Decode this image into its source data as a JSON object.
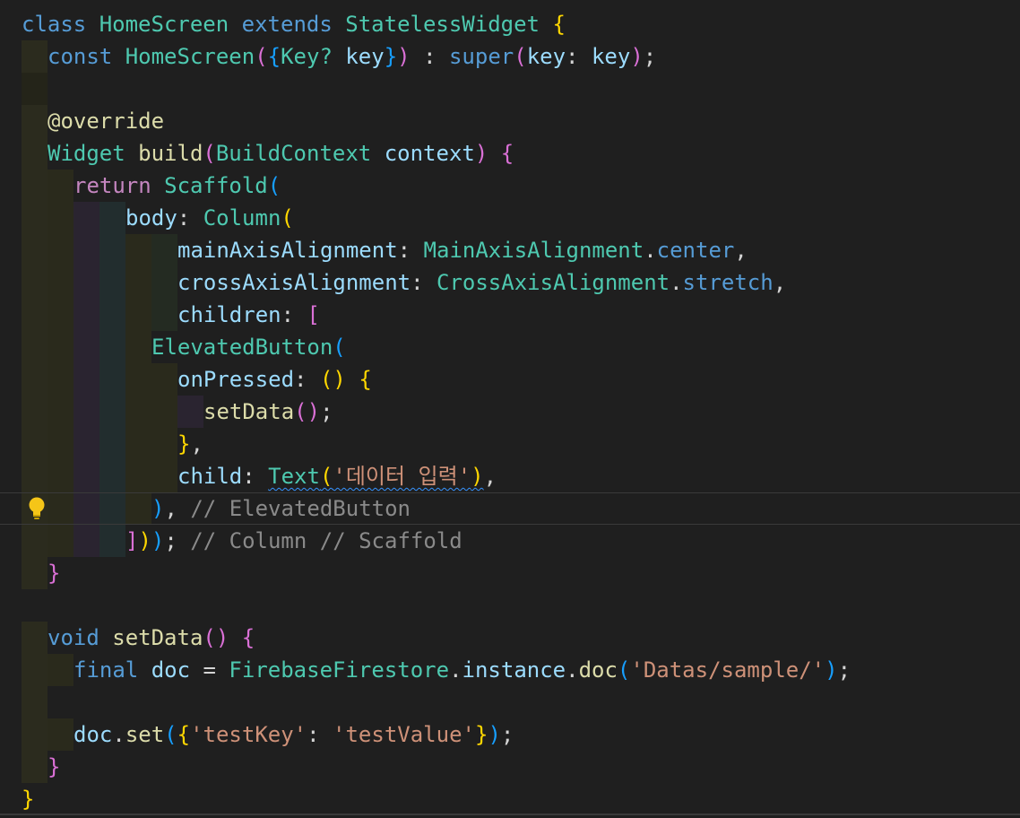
{
  "code": {
    "l1": {
      "kw_class": "class",
      "name": "HomeScreen",
      "kw_extends": "extends",
      "base": "StatelessWidget",
      "brace": "{"
    },
    "l2": {
      "kw_const": "const",
      "name": "HomeScreen",
      "p_open": "(",
      "b_open": "{",
      "type": "Key?",
      "param": "key",
      "b_close": "}",
      "p_close": ")",
      "colon": " : ",
      "super": "super",
      "sp_open": "(",
      "named": "key",
      "sep": ": ",
      "value": "key",
      "sp_close": ")",
      "semi": ";"
    },
    "l4": {
      "annotation": "@override"
    },
    "l5": {
      "ret_type": "Widget",
      "name": "build",
      "p_open": "(",
      "ptype": "BuildContext",
      "pname": "context",
      "p_close": ")",
      "brace": "{"
    },
    "l6": {
      "kw_return": "return",
      "widget": "Scaffold",
      "p_open": "("
    },
    "l7": {
      "prop": "body",
      "sep": ": ",
      "widget": "Column",
      "p_open": "("
    },
    "l8": {
      "prop": "mainAxisAlignment",
      "sep": ": ",
      "enum": "MainAxisAlignment",
      "dot": ".",
      "value": "center",
      "comma": ","
    },
    "l9": {
      "prop": "crossAxisAlignment",
      "sep": ": ",
      "enum": "CrossAxisAlignment",
      "dot": ".",
      "value": "stretch",
      "comma": ","
    },
    "l10": {
      "prop": "children",
      "sep": ": ",
      "bracket": "["
    },
    "l11": {
      "widget": "ElevatedButton",
      "p_open": "("
    },
    "l12": {
      "prop": "onPressed",
      "sep": ": ",
      "parens": "()",
      "brace": "{"
    },
    "l13": {
      "call": "setData",
      "parens": "()",
      "semi": ";"
    },
    "l14": {
      "brace": "}",
      "comma": ","
    },
    "l15": {
      "prop": "child",
      "sep": ": ",
      "widget": "Text",
      "p_open": "(",
      "string": "'데이터 입력'",
      "p_close": ")",
      "comma": ","
    },
    "l16": {
      "p_close": ")",
      "comma": ",",
      "comment": "// ElevatedButton"
    },
    "l17": {
      "bracket": "]",
      "p_close1": ")",
      "p_close2": ")",
      "semi": ";",
      "comment": "// Column // Scaffold"
    },
    "l18": {
      "brace": "}"
    },
    "l20": {
      "kw_void": "void",
      "name": "setData",
      "parens": "()",
      "brace": "{"
    },
    "l21": {
      "kw_final": "final",
      "var": "doc",
      "eq": " = ",
      "cls": "FirebaseFirestore",
      "dot1": ".",
      "member": "instance",
      "dot2": ".",
      "method": "doc",
      "p_open": "(",
      "string": "'Datas/sample/'",
      "p_close": ")",
      "semi": ";"
    },
    "l23": {
      "obj": "doc",
      "dot": ".",
      "method": "set",
      "p_open": "(",
      "b_open": "{",
      "key": "'testKey'",
      "sep": ": ",
      "value": "'testValue'",
      "b_close": "}",
      "p_close": ")",
      "semi": ";"
    },
    "l24": {
      "brace": "}"
    },
    "l25": {
      "brace": "}"
    }
  },
  "colors": {
    "background": "#1f1f1f",
    "keyword": "#569cd6",
    "control_keyword": "#c586c0",
    "type": "#4ec9b0",
    "function": "#dcdcaa",
    "variable": "#9cdcfe",
    "string": "#ce9178",
    "comment": "#8a8a8a",
    "bracket_gold": "#ffd700",
    "bracket_orchid": "#da70d6",
    "bracket_blue": "#179fff"
  },
  "gutter": {
    "lightbulb": "lightbulb-icon"
  }
}
